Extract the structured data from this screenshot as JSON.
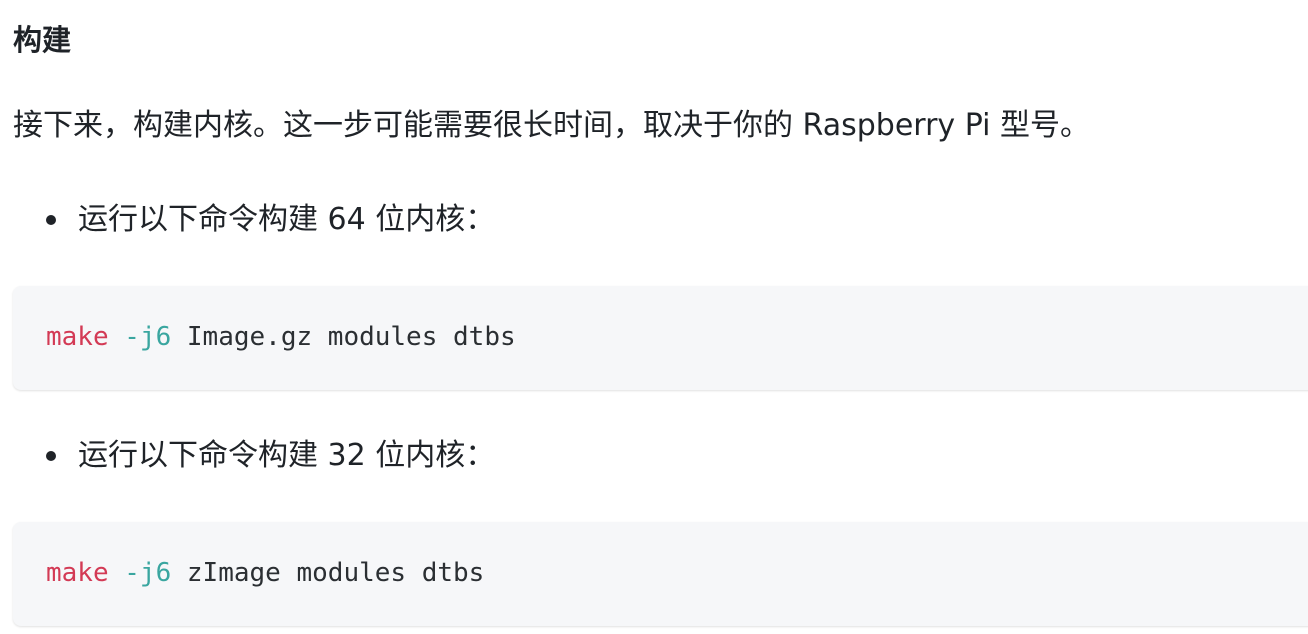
{
  "heading": "构建",
  "intro": "接下来，构建内核。这一步可能需要很长时间，取决于你的 Raspberry Pi 型号。",
  "items": [
    {
      "label": "运行以下命令构建 64 位内核：",
      "code": {
        "command": "make",
        "flag": "-j6",
        "args": "Image.gz modules dtbs"
      }
    },
    {
      "label": "运行以下命令构建 32 位内核：",
      "code": {
        "command": "make",
        "flag": "-j6",
        "args": "zImage modules dtbs"
      }
    }
  ],
  "colors": {
    "command": "#d33a55",
    "flag": "#3aa6a0",
    "code_background": "#f6f7f9",
    "text": "#1f2328"
  }
}
